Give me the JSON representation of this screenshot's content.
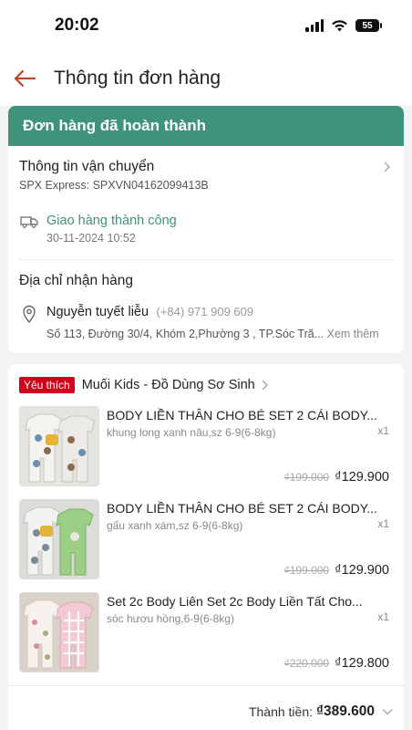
{
  "status_bar": {
    "time": "20:02",
    "battery": "55"
  },
  "header": {
    "title": "Thông tin đơn hàng"
  },
  "order": {
    "banner": "Đơn hàng đã hoàn thành",
    "shipping": {
      "title": "Thông tin vận chuyển",
      "carrier": "SPX Express: SPXVN04162099413B",
      "status": "Giao hàng thành công",
      "date": "30-11-2024 10:52"
    },
    "address": {
      "title": "Địa chỉ nhận hàng",
      "name": "Nguyễn tuyết liễu",
      "phone": "(+84) 971 909 609",
      "line": "Số 113, Đường 30/4, Khóm 2,Phường 3 , TP.Sóc Tră...",
      "more": "Xem thêm"
    }
  },
  "shop": {
    "badge": "Yêu thích",
    "name": "Muối Kids - Đồ Dùng Sơ Sinh",
    "products": [
      {
        "name": "BODY LIỀN THÂN CHO BÉ SET 2 CÁI BODY...",
        "variant": "khung long xanh nâu,sz 6-9(6-8kg)",
        "qty": "x1",
        "old_price": "₫199.000",
        "price": "₫129.900"
      },
      {
        "name": "BODY LIỀN THÂN CHO BÉ SET 2 CÁI BODY...",
        "variant": "gấu xanh xám,sz 6-9(6-8kg)",
        "qty": "x1",
        "old_price": "₫199.000",
        "price": "₫129.900"
      },
      {
        "name": "Set 2c Body Liên Set 2c Body Liền Tất Cho...",
        "variant": "sóc hươu hồng,6-9(6-8kg)",
        "qty": "x1",
        "old_price": "₫220.000",
        "price": "₫129.800"
      }
    ],
    "total_label": "Thành tiền:",
    "total_value": "₫389.600"
  },
  "colors": {
    "accent": "#3f937d",
    "back_arrow": "#c0462a",
    "badge": "#d0011b"
  },
  "icons": [
    "back-arrow-icon",
    "chevron-right-icon",
    "truck-icon",
    "location-pin-icon",
    "chevron-down-icon"
  ]
}
